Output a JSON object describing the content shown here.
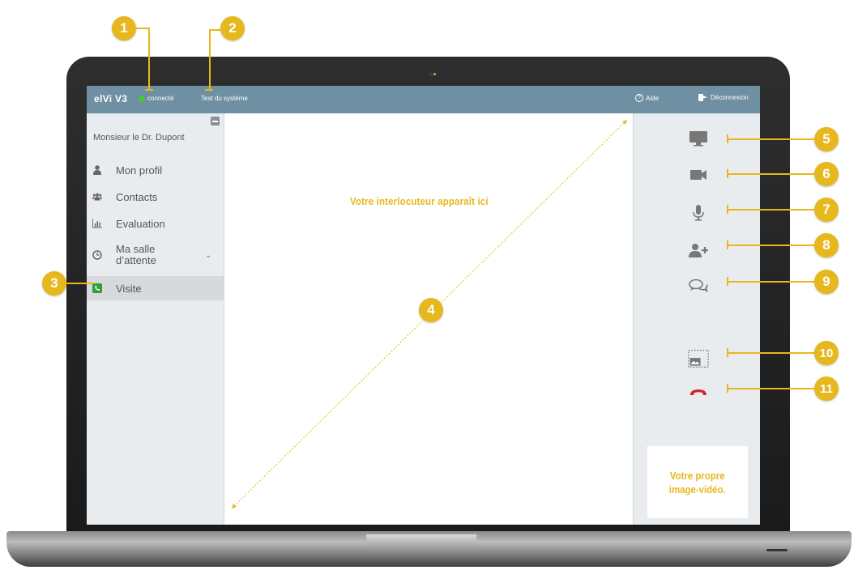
{
  "app": {
    "brand": "elVi V3",
    "status": "connecté",
    "system_test": "Test du système",
    "help": "Aide",
    "logout": "Déconnexion"
  },
  "sidebar": {
    "user": "Monsieur le Dr. Dupont",
    "items": [
      {
        "label": "Mon profil",
        "icon": "user-icon"
      },
      {
        "label": "Contacts",
        "icon": "contacts-icon"
      },
      {
        "label": "Evaluation",
        "icon": "chart-icon"
      },
      {
        "label": "Ma salle d'attente",
        "line1": "Ma salle",
        "line2": "d’attente",
        "icon": "clock-icon"
      },
      {
        "label": "Visite",
        "icon": "phone-icon",
        "active": true
      }
    ]
  },
  "main": {
    "placeholder": "Votre interlocuteur apparaît ici"
  },
  "controls": [
    "monitor-icon",
    "camera-icon",
    "microphone-icon",
    "add-user-icon",
    "chat-icon",
    "screenshot-icon",
    "hangup-icon"
  ],
  "self_view": {
    "line1": "Votre propre",
    "line2": "image-vidéo."
  },
  "callouts": [
    "1",
    "2",
    "3",
    "4",
    "5",
    "6",
    "7",
    "8",
    "9",
    "10",
    "11"
  ],
  "colors": {
    "topbar": "#6f8fa3",
    "accent": "#e6b81e",
    "status_green": "#4cc43a",
    "hangup_red": "#d8232a",
    "sidebar": "#e9ecee"
  }
}
